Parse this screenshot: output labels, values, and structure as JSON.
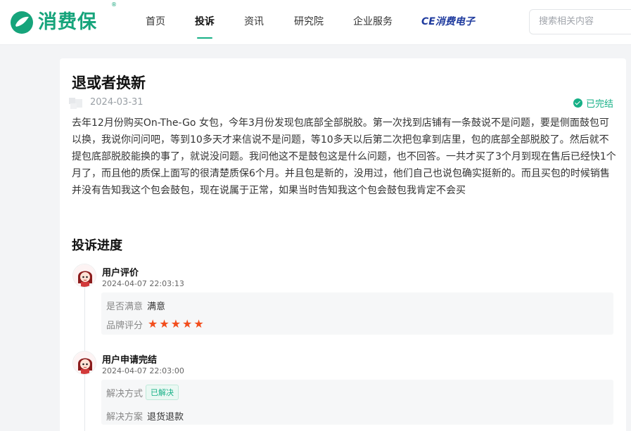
{
  "header": {
    "logo_text": "消费保",
    "logo_reg": "®",
    "nav": [
      {
        "label": "首页"
      },
      {
        "label": "投诉"
      },
      {
        "label": "资讯"
      },
      {
        "label": "研究院"
      },
      {
        "label": "企业服务"
      }
    ],
    "active_nav": "投诉",
    "brand_link": "CE消费电子",
    "search": {
      "placeholder": "搜索相关内容"
    }
  },
  "complaint": {
    "title": "退或者换新",
    "date": "2024-03-31",
    "status": "已完结",
    "body": "去年12月份购买On-The-Go 女包，今年3月份发现包底部全部脱胶。第一次找到店铺有一条鼓说不是问题，要是侧面鼓包可以换，我说你问问吧，等到10多天才来信说不是问题，等10多天以后第二次把包拿到店里，包的底部全部脱胶了。然后就不提包底部脱胶能换的事了，就说没问题。我问他这不是鼓包这是什么问题，也不回答。一共才买了3个月到现在售后已经快1个月了，而且他的质保上面写的很清楚质保6个月。并且包是新的，没用过，他们自己也说包确实挺新的。而且买包的时候销售并没有告知我这个包会鼓包，现在说属于正常，如果当时告知我这个包会鼓包我肯定不会买"
  },
  "progress": {
    "section_title": "投诉进度",
    "events": [
      {
        "title": "用户评价",
        "time": "2024-04-07 22:03:13",
        "rows": [
          {
            "label": "是否满意",
            "value": "满意"
          },
          {
            "label": "品牌评分",
            "rating": 5
          }
        ]
      },
      {
        "title": "用户申请完结",
        "time": "2024-04-07 22:03:00",
        "rows": [
          {
            "label": "解决方式",
            "badge": "已解决"
          },
          {
            "label": "解决方案",
            "value": "退货退款"
          }
        ]
      }
    ]
  },
  "colors": {
    "brand": "#16a47b",
    "accent": "#16b086",
    "star": "#f24d1c"
  }
}
